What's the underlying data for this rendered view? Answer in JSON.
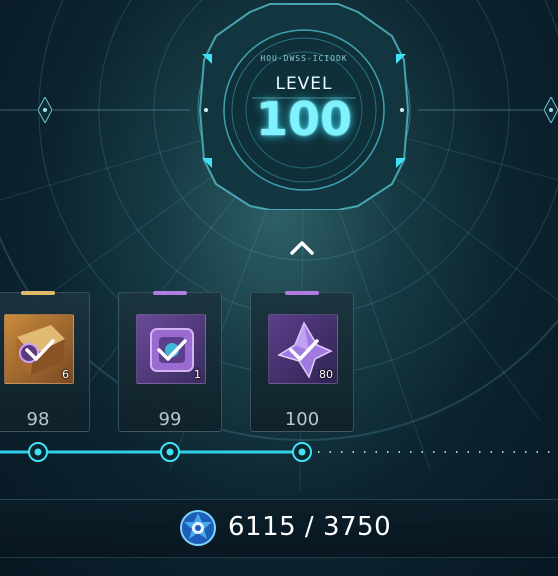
{
  "dial": {
    "code_text": "HOU-DWSS-ICIODK",
    "level_label": "LEVEL",
    "level_value": "100"
  },
  "rewards": [
    {
      "level": "98",
      "quantity": "6",
      "rarity_color": "#e0b96a",
      "claimed": true,
      "icon": "gold-crate-icon"
    },
    {
      "level": "99",
      "quantity": "1",
      "rarity_color": "#b27be0",
      "claimed": true,
      "icon": "purple-device-icon"
    },
    {
      "level": "100",
      "quantity": "80",
      "rarity_color": "#b27be0",
      "claimed": true,
      "icon": "purple-crystal-icon"
    }
  ],
  "currency": {
    "icon": "blue-emblem-icon",
    "text": "6115 / 3750"
  },
  "colors": {
    "accent": "#3fe3f5",
    "track": "#2fd0e8"
  }
}
